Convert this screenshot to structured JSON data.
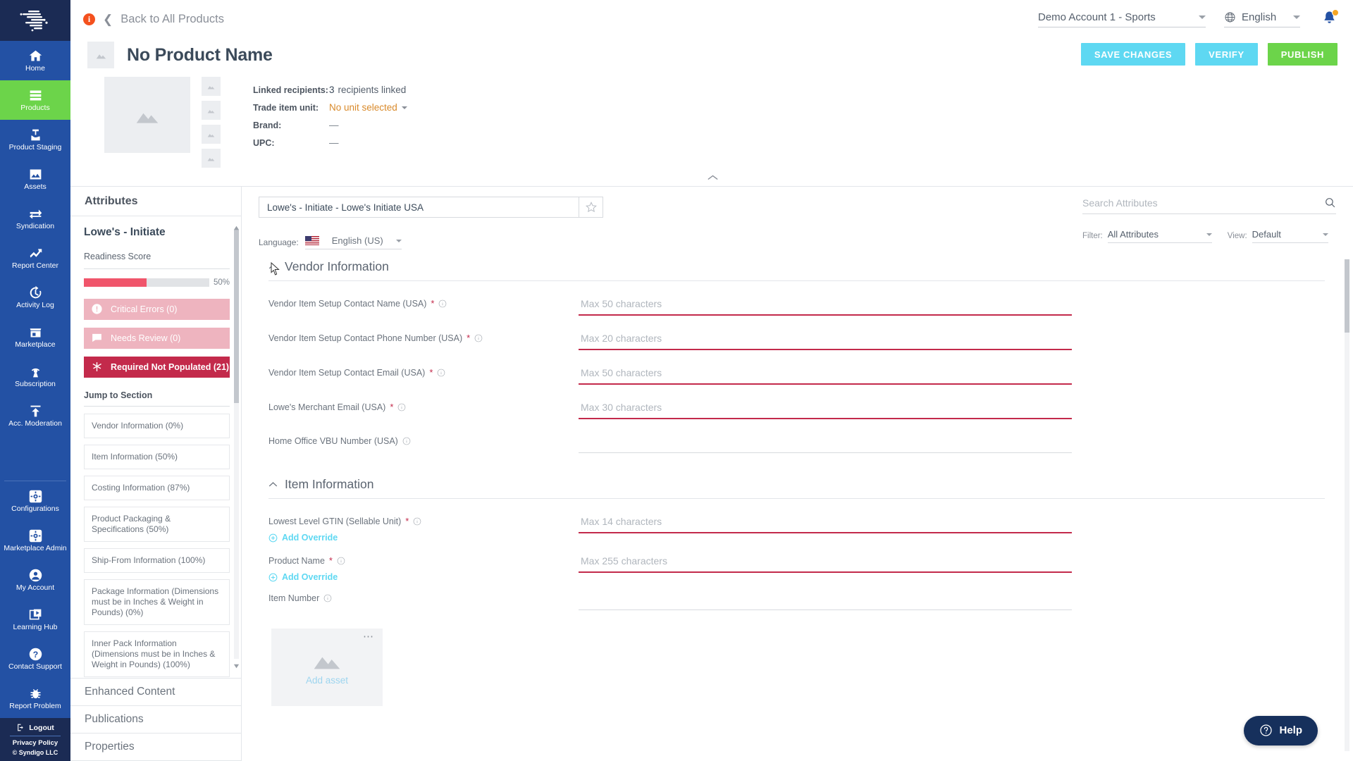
{
  "sidebar": {
    "logo_name": "syndigo-logo",
    "items": [
      {
        "label": "Home",
        "icon": "home-icon",
        "active": false
      },
      {
        "label": "Products",
        "icon": "products-icon",
        "active": true
      },
      {
        "label": "Product Staging",
        "icon": "product-staging-icon",
        "active": false
      },
      {
        "label": "Assets",
        "icon": "assets-icon",
        "active": false
      },
      {
        "label": "Syndication",
        "icon": "syndication-icon",
        "active": false
      },
      {
        "label": "Report Center",
        "icon": "report-center-icon",
        "active": false
      },
      {
        "label": "Activity Log",
        "icon": "activity-log-icon",
        "active": false
      },
      {
        "label": "Marketplace",
        "icon": "marketplace-icon",
        "active": false
      },
      {
        "label": "Subscription",
        "icon": "subscription-icon",
        "active": false
      },
      {
        "label": "Acc. Moderation",
        "icon": "acc-moderation-icon",
        "active": false
      }
    ],
    "bottom_items": [
      {
        "label": "Configurations",
        "icon": "gear-icon"
      },
      {
        "label": "Marketplace Admin",
        "icon": "gear-icon"
      },
      {
        "label": "My Account",
        "icon": "user-icon"
      },
      {
        "label": "Learning Hub",
        "icon": "play-video-icon"
      },
      {
        "label": "Contact Support",
        "icon": "question-icon"
      },
      {
        "label": "Report Problem",
        "icon": "bug-icon"
      }
    ],
    "logout_label": "Logout",
    "privacy_label": "Privacy Policy",
    "copyright": "© Syndigo LLC"
  },
  "topbar": {
    "back_label": "Back to All Products",
    "info_badge": "i",
    "account": "Demo Account 1 - Sports",
    "language": "English"
  },
  "product": {
    "title": "No Product Name",
    "buttons": {
      "save": "SAVE CHANGES",
      "verify": "VERIFY",
      "publish": "PUBLISH"
    },
    "meta": [
      {
        "key": "Linked recipients:",
        "value": "3",
        "suffix": "recipients linked",
        "type": "count"
      },
      {
        "key": "Trade item unit:",
        "value": "No unit selected",
        "type": "dropdown"
      },
      {
        "key": "Brand:",
        "value": "—",
        "type": "text"
      },
      {
        "key": "UPC:",
        "value": "—",
        "type": "text"
      }
    ]
  },
  "attributes_panel": {
    "header": "Attributes",
    "recipient": "Lowe's - Initiate",
    "readiness_label": "Readiness Score",
    "readiness_percent": "50%",
    "readiness_value": 50,
    "statuses": [
      {
        "label": "Critical Errors (0)",
        "icon": "alert-icon",
        "style": "muted"
      },
      {
        "label": "Needs Review (0)",
        "icon": "comment-icon",
        "style": "muted"
      },
      {
        "label": "Required Not Populated (21)",
        "icon": "asterisk-icon",
        "style": "strong"
      }
    ],
    "jump_title": "Jump to Section",
    "jump_items": [
      "Vendor Information (0%)",
      "Item Information (50%)",
      "Costing Information (87%)",
      "Product Packaging & Specifications (50%)",
      "Ship-From Information (100%)",
      "Package Information (Dimensions must be in Inches & Weight in Pounds) (0%)",
      "Inner Pack Information (Dimensions must be in Inches & Weight in Pounds) (100%)"
    ],
    "accordion": [
      "Enhanced Content",
      "Publications",
      "Properties"
    ]
  },
  "form": {
    "recipient_select": "Lowe's - Initiate  -  Lowe's Initiate USA",
    "language_label": "Language:",
    "language_value": "English (US)",
    "search_placeholder": "Search Attributes",
    "search_value": "",
    "filter_label": "Filter:",
    "filter_value": "All Attributes",
    "view_label": "View:",
    "view_value": "Default",
    "add_override_label": "Add Override",
    "sections": [
      {
        "title": "Vendor Information",
        "fields": [
          {
            "label": "Vendor Item Setup Contact Name (USA)",
            "required": true,
            "placeholder": "Max 50 characters",
            "value": "",
            "invalid": true,
            "override": false
          },
          {
            "label": "Vendor Item Setup Contact Phone Number (USA)",
            "required": true,
            "placeholder": "Max 20 characters",
            "value": "",
            "invalid": true,
            "override": false
          },
          {
            "label": "Vendor Item Setup Contact Email (USA)",
            "required": true,
            "placeholder": "Max 50 characters",
            "value": "",
            "invalid": true,
            "override": false
          },
          {
            "label": "Lowe's Merchant Email (USA)",
            "required": true,
            "placeholder": "Max 30 characters",
            "value": "",
            "invalid": true,
            "override": false
          },
          {
            "label": "Home Office VBU Number (USA)",
            "required": false,
            "placeholder": "",
            "value": "",
            "invalid": false,
            "override": false
          }
        ]
      },
      {
        "title": "Item Information",
        "fields": [
          {
            "label": "Lowest Level GTIN (Sellable Unit)",
            "required": true,
            "placeholder": "Max 14 characters",
            "value": "",
            "invalid": true,
            "override": true
          },
          {
            "label": "Product Name",
            "required": true,
            "placeholder": "Max 255 characters",
            "value": "",
            "invalid": true,
            "override": true
          },
          {
            "label": "Item Number",
            "required": false,
            "placeholder": "",
            "value": "",
            "invalid": false,
            "override": false
          }
        ]
      }
    ],
    "asset_label": "Add asset"
  },
  "help": {
    "label": "Help"
  },
  "colors": {
    "nav_bg": "#2351a4",
    "nav_active": "#6cd44a",
    "accent_cyan": "#5ed8f2",
    "accent_green": "#6cd44a",
    "danger": "#c32a4b",
    "readiness_fill": "#f0556b"
  }
}
